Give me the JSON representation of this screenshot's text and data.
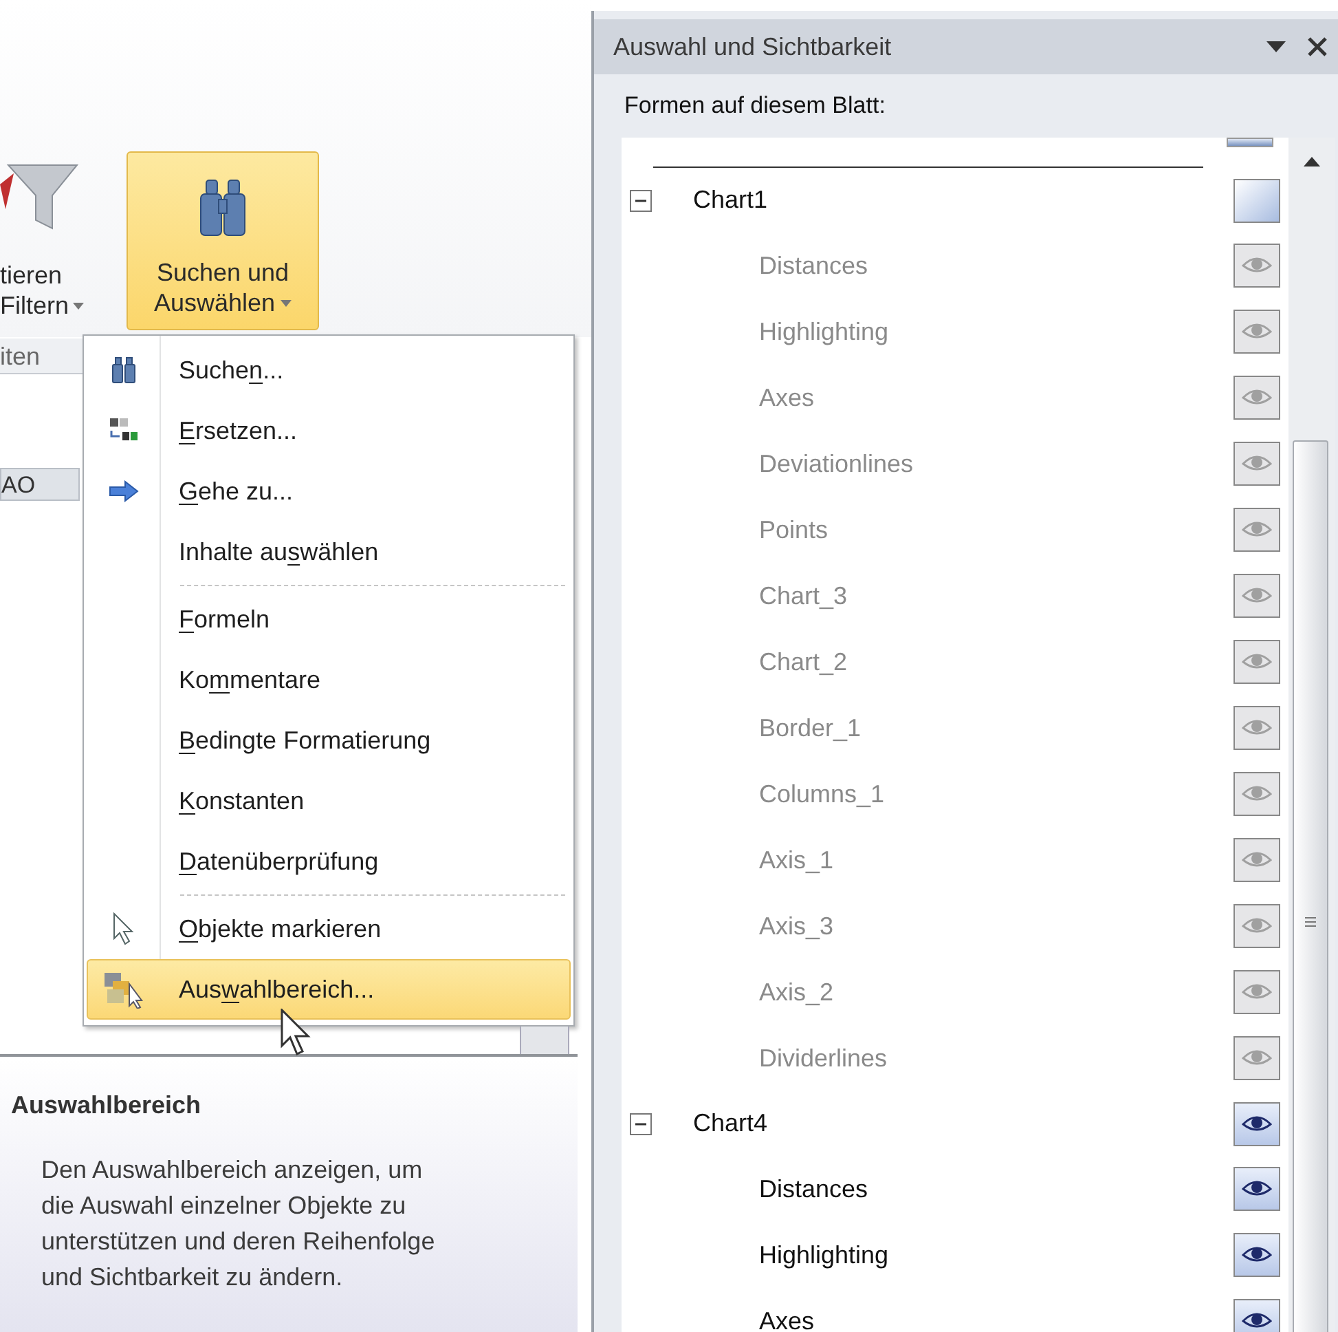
{
  "ribbon": {
    "partial_button": {
      "line_1": "tieren",
      "line_2": "Filtern"
    },
    "button": {
      "line_1": "Suchen und",
      "line_2": "Auswählen",
      "selected": true
    },
    "group_label": "iten",
    "column_header": "AO"
  },
  "menu": {
    "items": [
      {
        "kind": "item",
        "pre": "Suche",
        "key": "n",
        "post": "...",
        "selected": false
      },
      {
        "kind": "item",
        "key": "E",
        "post": "rsetzen...",
        "selected": false
      },
      {
        "kind": "item",
        "key": "G",
        "post": "ehe zu...",
        "selected": false
      },
      {
        "kind": "item",
        "pre": "Inhalte au",
        "key": "s",
        "post": "wählen",
        "selected": false
      },
      {
        "kind": "separator"
      },
      {
        "kind": "item",
        "key": "F",
        "post": "ormeln",
        "selected": false
      },
      {
        "kind": "item",
        "pre": "Ko",
        "key": "m",
        "post": "mentare",
        "selected": false
      },
      {
        "kind": "item",
        "key": "B",
        "post": "edingte Formatierung",
        "selected": false
      },
      {
        "kind": "item",
        "key": "K",
        "post": "onstanten",
        "selected": false
      },
      {
        "kind": "item",
        "key": "D",
        "post": "atenüberprüfung",
        "selected": false
      },
      {
        "kind": "separator"
      },
      {
        "kind": "item",
        "key": "O",
        "post": "bjekte markieren",
        "selected": false
      },
      {
        "kind": "item",
        "pre": "Aus",
        "key": "w",
        "post": "ahlbereich...",
        "selected": true
      }
    ]
  },
  "tooltip": {
    "title": "Auswahlbereich",
    "text": "Den Auswahlbereich anzeigen, um die Auswahl einzelner Objekte zu unterstützen und deren Reihenfolge und Sichtbarkeit zu ändern."
  },
  "panel": {
    "title": "Auswahl und Sichtbarkeit",
    "label": "Formen auf diesem Blatt:",
    "shapes": [
      {
        "name": "Chart1",
        "expanded": true,
        "kind": "mixed",
        "children": [
          {
            "name": "Distances",
            "visible": false
          },
          {
            "name": "Highlighting",
            "visible": false
          },
          {
            "name": "Axes",
            "visible": false
          },
          {
            "name": "Deviationlines",
            "visible": false
          },
          {
            "name": "Points",
            "visible": false
          },
          {
            "name": "Chart_3",
            "visible": false
          },
          {
            "name": "Chart_2",
            "visible": false
          },
          {
            "name": "Border_1",
            "visible": false
          },
          {
            "name": "Columns_1",
            "visible": false
          },
          {
            "name": "Axis_1",
            "visible": false
          },
          {
            "name": "Axis_3",
            "visible": false
          },
          {
            "name": "Axis_2",
            "visible": false
          },
          {
            "name": "Dividerlines",
            "visible": false
          }
        ]
      },
      {
        "name": "Chart4",
        "expanded": true,
        "kind": "visible",
        "children": [
          {
            "name": "Distances",
            "visible": true
          },
          {
            "name": "Highlighting",
            "visible": true
          },
          {
            "name": "Axes",
            "visible": true
          }
        ]
      }
    ]
  }
}
